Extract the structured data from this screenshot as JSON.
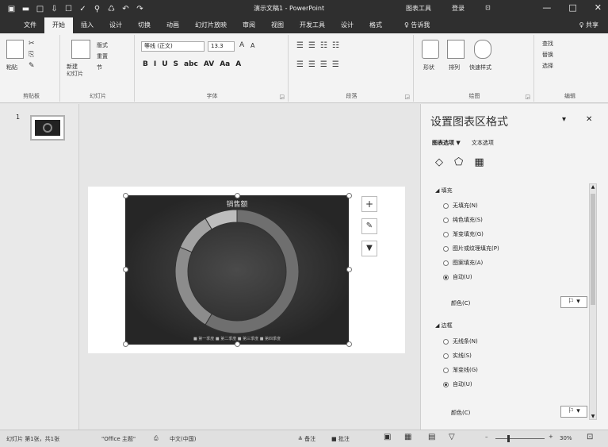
{
  "titlebar": {
    "quick_access": [
      "▣",
      "▬",
      "□",
      "⇩",
      "☐",
      "✓",
      "⚲",
      "♺",
      "↶",
      "↷"
    ],
    "title": "演示文稿1 - PowerPoint",
    "context_tabs": [
      "图表工具",
      "登录",
      "⊡"
    ],
    "win": [
      "—",
      "□",
      "✕"
    ]
  },
  "tabs": {
    "items": [
      "文件",
      "开始",
      "插入",
      "设计",
      "切换",
      "动画",
      "幻灯片放映",
      "审阅",
      "视图",
      "开发工具",
      "设计",
      "格式"
    ],
    "active_index": 1,
    "tell_me": "♀ 告诉我",
    "share": "♀ 共享"
  },
  "ribbon": {
    "clipboard": {
      "paste": "粘贴",
      "label": "剪贴板"
    },
    "slides": {
      "new_slide": "新建\n幻灯片",
      "layout": "版式",
      "reset": "重置",
      "section": "节",
      "label": "幻灯片"
    },
    "font": {
      "font_name": "等线 (正文)",
      "font_size": "13.3",
      "format_buttons": [
        "B",
        "I",
        "U",
        "S",
        "abc",
        "AV",
        "Aa",
        "A"
      ],
      "grow": "A",
      "shrink": "A",
      "label": "字体"
    },
    "paragraph": {
      "label": "段落"
    },
    "drawing": {
      "shape": "形状",
      "arrange": "排列",
      "quick_styles": "快速样式",
      "label": "绘图"
    },
    "editing": {
      "find": "查找",
      "replace": "替换",
      "select": "选择",
      "label": "编辑"
    }
  },
  "slide_pane": {
    "slide_number": "1"
  },
  "chart": {
    "title": "销售额",
    "legend": "■ 第一季度  ■ 第二季度  ■ 第三季度  ■ 第四季度"
  },
  "chart_data": {
    "type": "pie",
    "title": "销售额",
    "categories": [
      "第一季度",
      "第二季度",
      "第三季度",
      "第四季度"
    ],
    "values": [
      8.2,
      3.2,
      1.4,
      1.2
    ],
    "colors": [
      "#6f6f6f",
      "#8c8c8c",
      "#a3a3a3",
      "#bdbdbd"
    ],
    "style": "doughnut",
    "legend": "bottom"
  },
  "chart_buttons": [
    "+",
    "✎",
    "▼"
  ],
  "pane": {
    "title": "设置图表区格式",
    "controls": [
      "▾",
      "✕"
    ],
    "tabs": [
      "图表选项 ▼",
      "文本选项"
    ],
    "icons": [
      "◇",
      "⬠",
      "▦"
    ],
    "fill_header": "◢ 填充",
    "fill_options": [
      {
        "label": "无填充(N)",
        "checked": false
      },
      {
        "label": "纯色填充(S)",
        "checked": false
      },
      {
        "label": "渐变填充(G)",
        "checked": false
      },
      {
        "label": "图片或纹理填充(P)",
        "checked": false
      },
      {
        "label": "图案填充(A)",
        "checked": false
      },
      {
        "label": "自动(U)",
        "checked": true
      }
    ],
    "color_label": "颜色(C)",
    "color_button": "⚐ ▾",
    "border_header": "◢ 边框",
    "border_options": [
      {
        "label": "无线条(N)",
        "checked": false
      },
      {
        "label": "实线(S)",
        "checked": false
      },
      {
        "label": "渐变线(G)",
        "checked": false
      },
      {
        "label": "自动(U)",
        "checked": true
      }
    ],
    "border_color_label": "颜色(C)"
  },
  "status": {
    "slide_info": "幻灯片 第1张，共1张",
    "theme": "\"Office 主题\"",
    "language": "中文(中国)",
    "notes": "≜ 备注",
    "comments": "■ 批注",
    "zoom": "30%"
  }
}
